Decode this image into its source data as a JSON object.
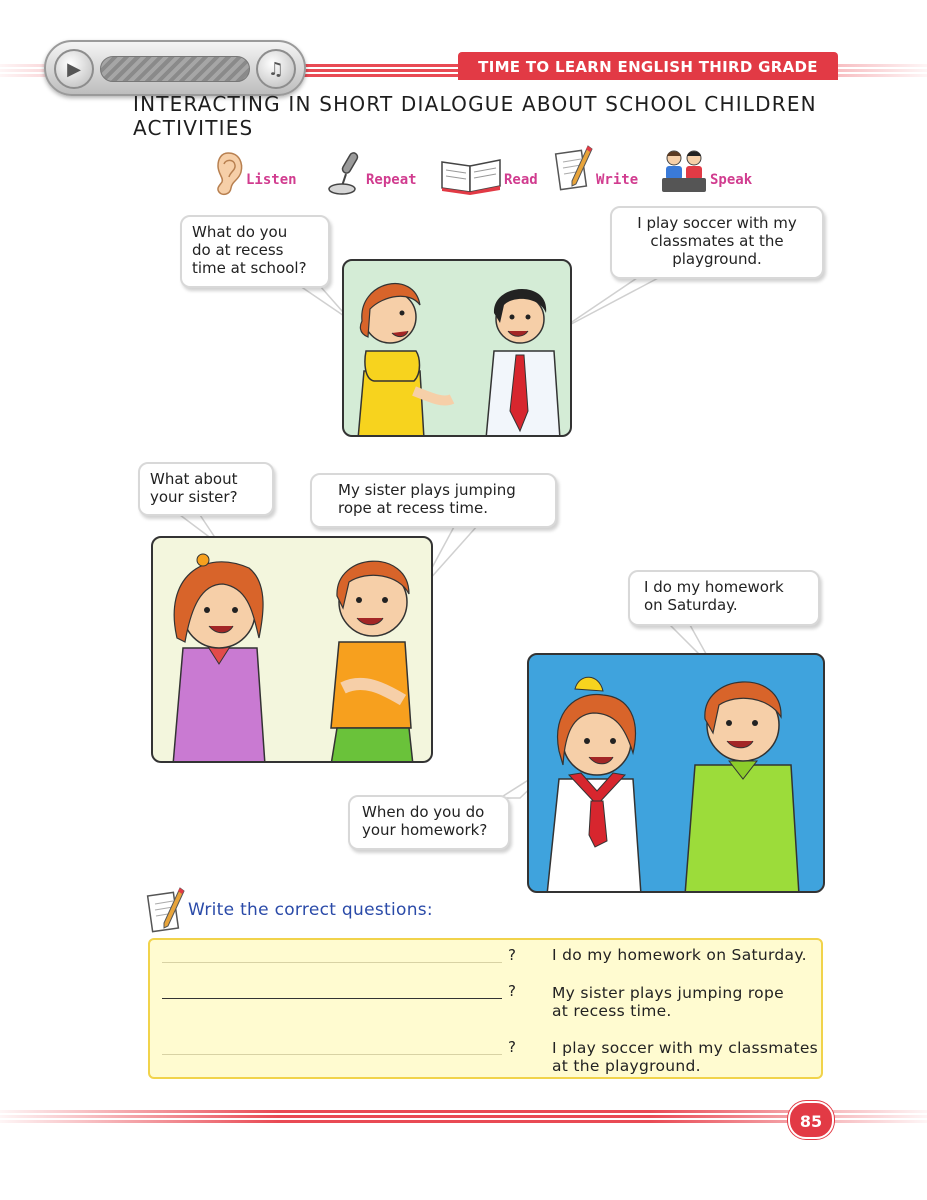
{
  "header": {
    "series_title": "TIME TO LEARN ENGLISH THIRD GRADE"
  },
  "page_title": "INTERACTING IN SHORT DIALOGUE ABOUT SCHOOL CHILDREN ACTIVITIES",
  "skills": [
    {
      "label": "Listen",
      "icon": "ear-icon"
    },
    {
      "label": "Repeat",
      "icon": "microphone-icon"
    },
    {
      "label": "Read",
      "icon": "open-book-icon"
    },
    {
      "label": "Write",
      "icon": "pencil-paper-icon"
    },
    {
      "label": "Speak",
      "icon": "children-talking-icon"
    }
  ],
  "dialogues": {
    "scene1": {
      "question": "What do you\ndo at recess\ntime at school?",
      "answer": "I play soccer with my\nclassmates at the\nplayground."
    },
    "scene2": {
      "question": "What about\nyour sister?",
      "answer": "My sister plays jumping\nrope at recess time."
    },
    "scene3": {
      "question": "When do you do\nyour homework?",
      "answer": "I do my homework\non Saturday."
    }
  },
  "exercise": {
    "instruction": "Write the correct questions:",
    "rows": [
      {
        "mark": "?",
        "answer": "I do my homework on Saturday."
      },
      {
        "mark": "?",
        "answer": "My sister plays jumping rope\nat recess time."
      },
      {
        "mark": "?",
        "answer": "I play soccer with my classmates\nat the playground."
      }
    ]
  },
  "page_number": "85",
  "colors": {
    "accent_red": "#e23a45",
    "skill_pink": "#d13c8f",
    "exercise_blue": "#2a4aa8",
    "answer_box_fill": "#fffbd0",
    "answer_box_border": "#f1d34b",
    "scene1_bg": "#d4ecd6",
    "scene2_bg": "#f3f6dd",
    "scene3_bg": "#3fa3dd"
  }
}
